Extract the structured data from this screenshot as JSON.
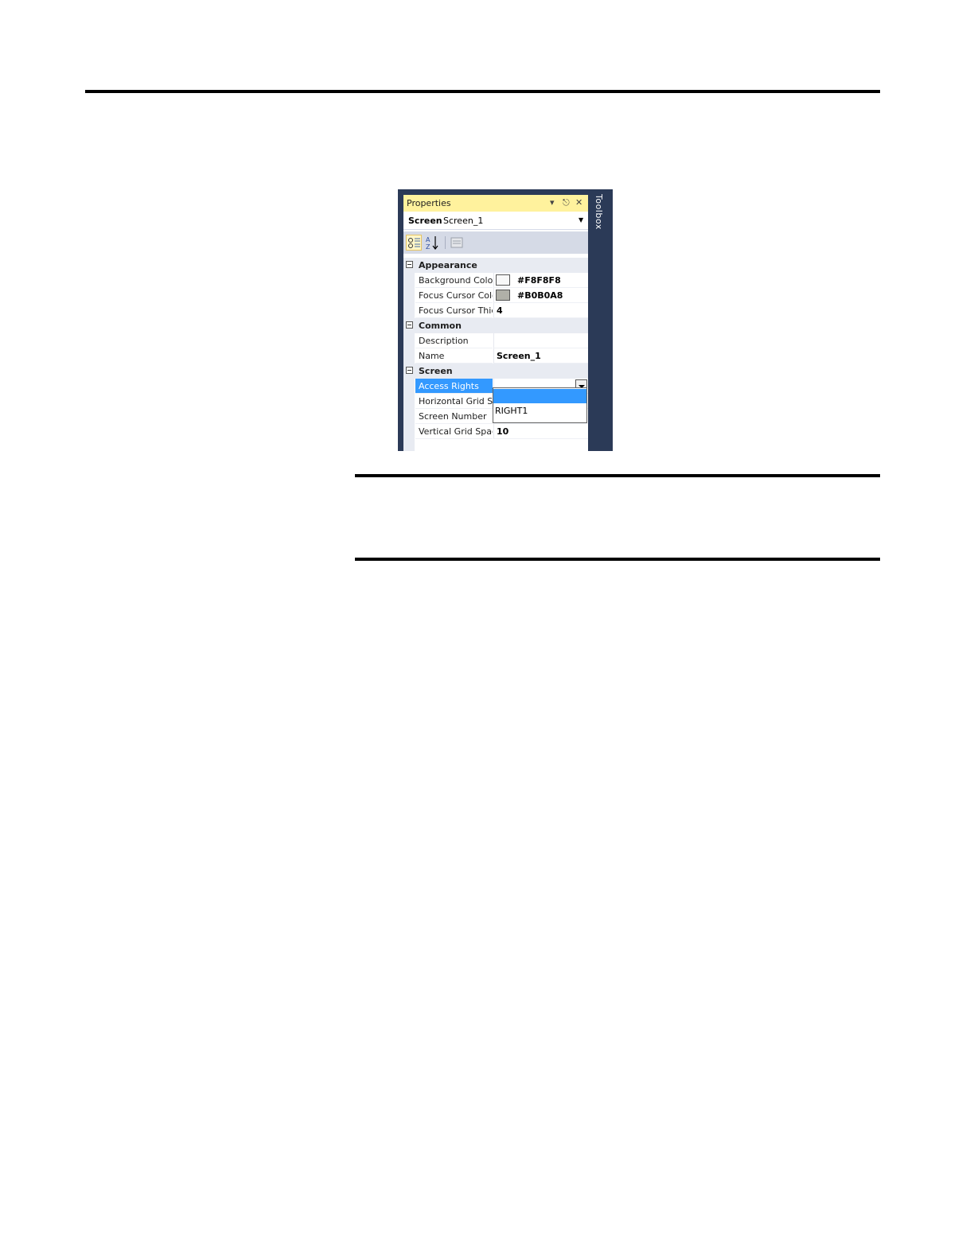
{
  "panel": {
    "title": "Properties",
    "toolbox_label": "Toolbox",
    "object_type": "Screen",
    "object_name": "Screen_1"
  },
  "categories": {
    "appearance": "Appearance",
    "common": "Common",
    "screen": "Screen"
  },
  "properties": {
    "background_color": {
      "name": "Background Colo",
      "value": "#F8F8F8",
      "swatch": "#F8F8F8"
    },
    "focus_cursor_color": {
      "name": "Focus Cursor Colo",
      "value": "#B0B0A8",
      "swatch": "#B0B0A8"
    },
    "focus_cursor_thickness": {
      "name": "Focus Cursor Thic",
      "value": "4"
    },
    "description": {
      "name": "Description",
      "value": ""
    },
    "name": {
      "name": "Name",
      "value": "Screen_1"
    },
    "access_rights": {
      "name": "Access Rights",
      "value": ""
    },
    "horizontal_grid": {
      "name": "Horizontal Grid Sp",
      "value": ""
    },
    "screen_number": {
      "name": "Screen Number",
      "value": ""
    },
    "vertical_grid": {
      "name": "Vertical Grid Spac",
      "value": "10"
    }
  },
  "dropdown": {
    "options": [
      "",
      "RIGHT1"
    ]
  },
  "colors": {
    "selection": "#3399ff",
    "title_bar": "#fff29d",
    "frame": "#2b3a57"
  }
}
